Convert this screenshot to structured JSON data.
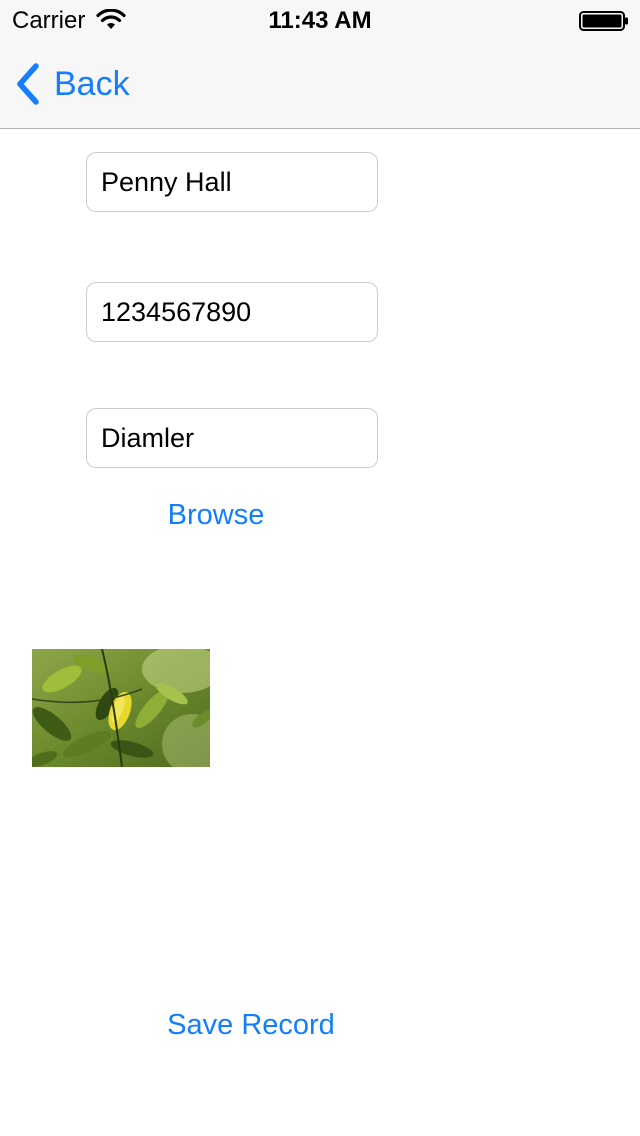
{
  "status_bar": {
    "carrier": "Carrier",
    "time": "11:43 AM",
    "icons": [
      "wifi-icon",
      "battery-icon"
    ]
  },
  "nav_bar": {
    "back_label": "Back",
    "back_icon": "chevron-left-icon",
    "accent_color": "#147efb"
  },
  "form": {
    "name_value": "Penny Hall",
    "phone_value": "1234567890",
    "company_value": "Diamler",
    "browse_label": "Browse",
    "save_label": "Save Record"
  },
  "photo": {
    "description_icon": "leaf-photo"
  }
}
